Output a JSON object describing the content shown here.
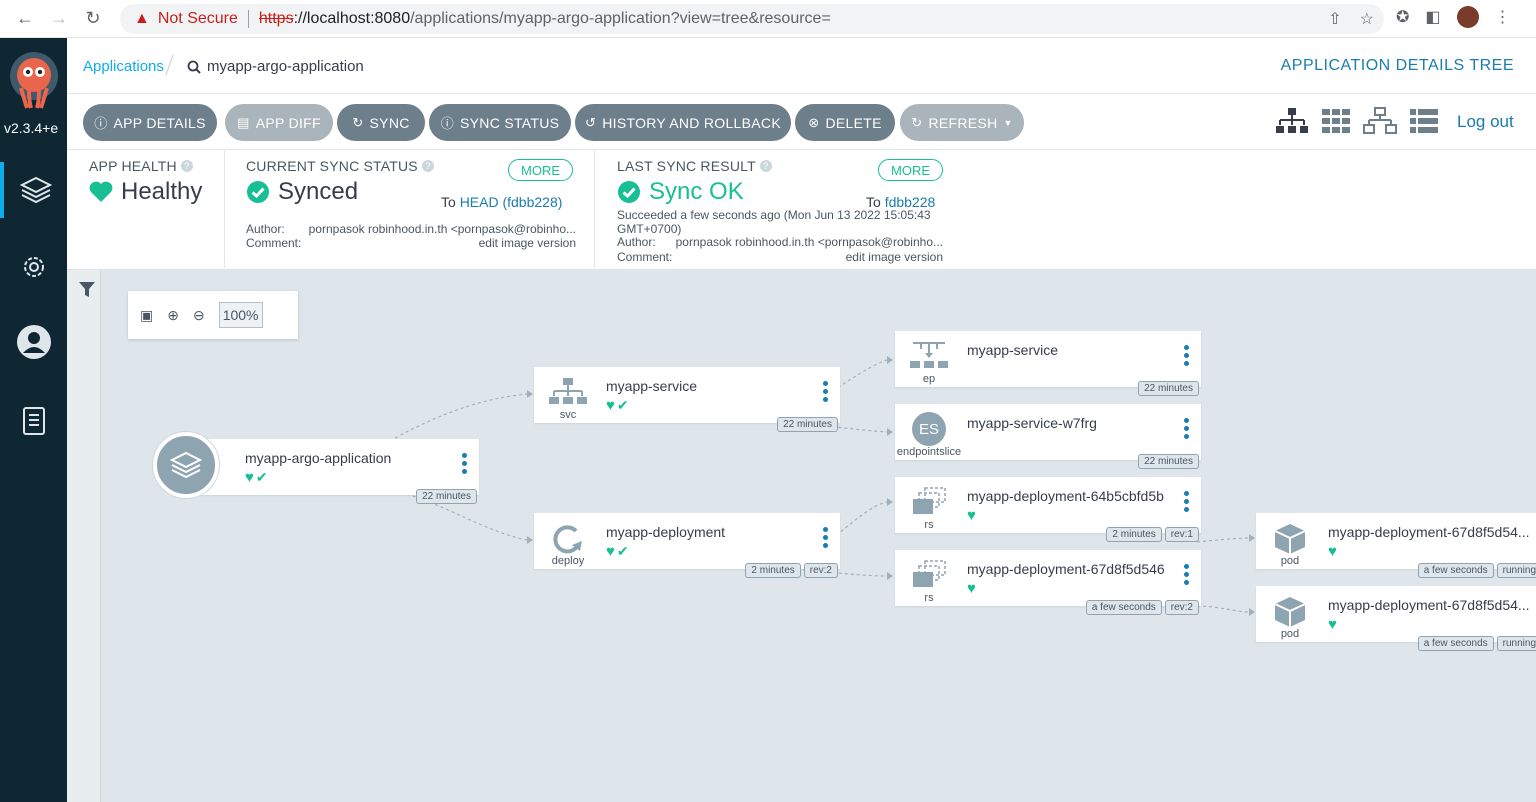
{
  "browser": {
    "security": "Not Secure",
    "url_scheme": "https",
    "url_host": "://localhost:8080",
    "url_path": "/applications/myapp-argo-application?view=tree&resource="
  },
  "sidebar": {
    "version": "v2.3.4+e"
  },
  "breadcrumb": {
    "root": "Applications",
    "current": "myapp-argo-application"
  },
  "page_title": "APPLICATION DETAILS TREE",
  "toolbar": {
    "app_details": "APP DETAILS",
    "app_diff": "APP DIFF",
    "sync": "SYNC",
    "sync_status": "SYNC STATUS",
    "history": "HISTORY AND ROLLBACK",
    "delete": "DELETE",
    "refresh": "REFRESH",
    "logout": "Log out"
  },
  "status": {
    "health_label": "APP HEALTH",
    "health_value": "Healthy",
    "sync_label": "CURRENT SYNC STATUS",
    "sync_value": "Synced",
    "sync_more": "MORE",
    "sync_to_prefix": "To",
    "sync_to": "HEAD (fdbb228)",
    "sync_author_label": "Author:",
    "sync_author": "pornpasok robinhood.in.th <pornpasok@robinho...",
    "sync_comment_label": "Comment:",
    "sync_comment": "edit image version",
    "last_label": "LAST SYNC RESULT",
    "last_value": "Sync OK",
    "last_more": "MORE",
    "last_to_prefix": "To",
    "last_to": "fdbb228",
    "last_succeeded": "Succeeded a few seconds ago (Mon Jun 13 2022 15:05:43",
    "last_tz": "GMT+0700)",
    "last_author_label": "Author:",
    "last_author": "pornpasok robinhood.in.th <pornpasok@robinho...",
    "last_comment_label": "Comment:",
    "last_comment": "edit image version"
  },
  "zoom": {
    "level": "100%"
  },
  "colors": {
    "healthy": "#18be94",
    "accent": "#0dadea",
    "sidebar": "#0f2733",
    "button": "#6d7f8b"
  },
  "nodes": {
    "app": {
      "name": "myapp-argo-application",
      "age": "22 minutes"
    },
    "svc": {
      "kind": "svc",
      "name": "myapp-service",
      "age": "22 minutes"
    },
    "deploy": {
      "kind": "deploy",
      "name": "myapp-deployment",
      "age": "2 minutes",
      "rev": "rev:2"
    },
    "ep": {
      "kind": "ep",
      "name": "myapp-service",
      "age": "22 minutes"
    },
    "eps": {
      "kind": "endpointslice",
      "badge": "ES",
      "name": "myapp-service-w7frg",
      "age": "22 minutes"
    },
    "rs1": {
      "kind": "rs",
      "name": "myapp-deployment-64b5cbfd5b",
      "age": "2 minutes",
      "rev": "rev:1"
    },
    "rs2": {
      "kind": "rs",
      "name": "myapp-deployment-67d8f5d546",
      "age": "a few seconds",
      "rev": "rev:2"
    },
    "pod1": {
      "kind": "pod",
      "name": "myapp-deployment-67d8f5d54...",
      "age": "a few seconds",
      "state": "running"
    },
    "pod2": {
      "kind": "pod",
      "name": "myapp-deployment-67d8f5d54...",
      "age": "a few seconds",
      "state": "running"
    }
  }
}
